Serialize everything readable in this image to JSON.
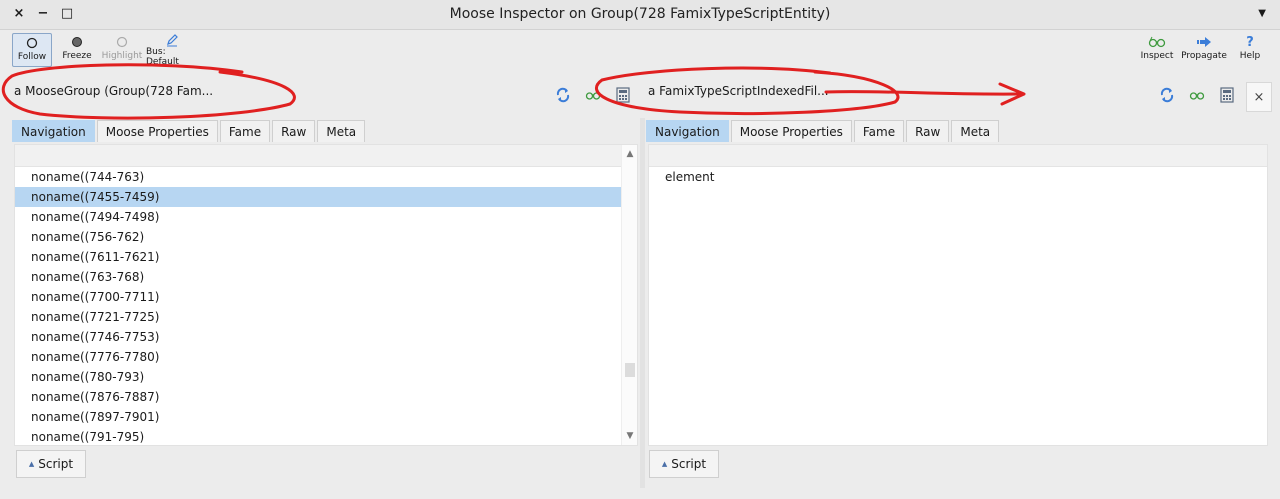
{
  "window": {
    "title": "Moose Inspector on Group(728 FamixTypeScriptEntity)",
    "close_glyph": "×",
    "minimize_glyph": "−",
    "maximize_glyph": "□",
    "menu_glyph": "▼"
  },
  "toolbar": {
    "follow": "Follow",
    "freeze": "Freeze",
    "highlight": "Highlight",
    "bus": "Bus: Default",
    "inspect": "Inspect",
    "propagate": "Propagate",
    "help": "Help",
    "help_glyph": "?"
  },
  "left_pane": {
    "title": "a MooseGroup (Group(728 Fam...",
    "tabs": [
      "Navigation",
      "Moose Properties",
      "Fame",
      "Raw",
      "Meta"
    ],
    "active_tab": "Navigation",
    "items": [
      "noname((744-763)",
      "noname((7455-7459)",
      "noname((7494-7498)",
      "noname((756-762)",
      "noname((7611-7621)",
      "noname((763-768)",
      "noname((7700-7711)",
      "noname((7721-7725)",
      "noname((7746-7753)",
      "noname((7776-7780)",
      "noname((780-793)",
      "noname((7876-7887)",
      "noname((7897-7901)",
      "noname((791-795)"
    ],
    "selected_item": "noname((7455-7459)",
    "script_label": "Script"
  },
  "right_pane": {
    "title": "a FamixTypeScriptIndexedFil...",
    "tabs": [
      "Navigation",
      "Moose Properties",
      "Fame",
      "Raw",
      "Meta"
    ],
    "active_tab": "Navigation",
    "items": [
      "element"
    ],
    "script_label": "Script",
    "close_glyph": "×"
  },
  "colors": {
    "selection": "#b7d6f2",
    "annotation": "#e02020",
    "icon_blue": "#3b7dd8",
    "icon_green": "#3e9a3e"
  }
}
